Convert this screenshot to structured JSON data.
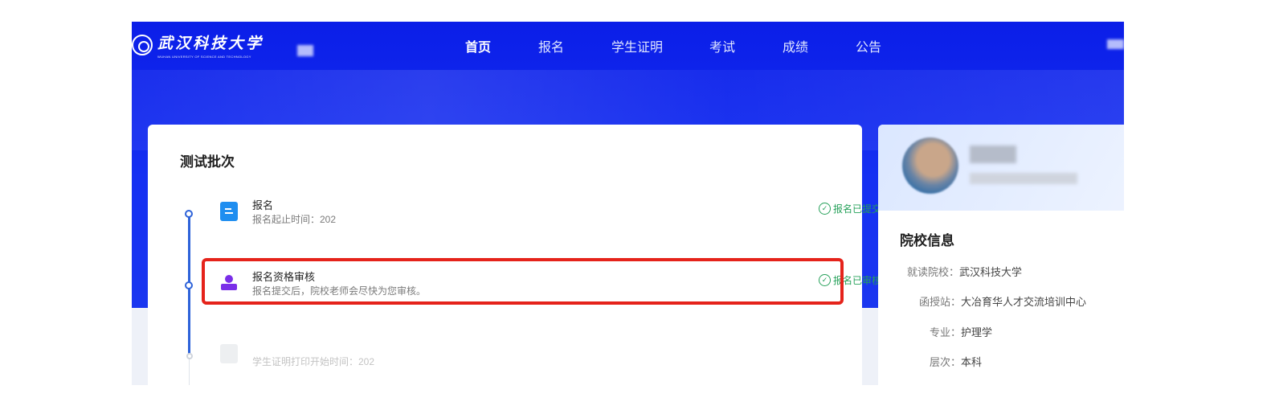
{
  "header": {
    "logo_cn": "武汉科技大学",
    "logo_en": "WUHAN UNIVERSITY OF SCIENCE AND TECHNOLOGY",
    "nav": [
      {
        "label": "首页",
        "active": true
      },
      {
        "label": "报名",
        "active": false
      },
      {
        "label": "学生证明",
        "active": false
      },
      {
        "label": "考试",
        "active": false
      },
      {
        "label": "成绩",
        "active": false
      },
      {
        "label": "公告",
        "active": false
      }
    ]
  },
  "batch": {
    "title": "测试批次",
    "steps": [
      {
        "title": "报名",
        "desc": "报名起止时间：202",
        "status": "报名已提交",
        "icon": "document-icon"
      },
      {
        "title": "报名资格审核",
        "desc": "报名提交后，院校老师会尽快为您审核。",
        "status": "报名已审核",
        "icon": "stamp-icon"
      },
      {
        "title": "",
        "desc": "学生证明打印开始时间：202",
        "status": "",
        "icon": "printer-icon"
      }
    ]
  },
  "school": {
    "title": "院校信息",
    "rows": [
      {
        "label": "就读院校：",
        "value": "武汉科技大学"
      },
      {
        "label": "函授站：",
        "value": "大冶育华人才交流培训中心"
      },
      {
        "label": "专业：",
        "value": "护理学"
      },
      {
        "label": "层次：",
        "value": "本科"
      }
    ]
  },
  "colors": {
    "hero": "#1530f2",
    "timeline": "#2d62d9",
    "status_green": "#26a15a",
    "highlight": "#e5231b"
  }
}
